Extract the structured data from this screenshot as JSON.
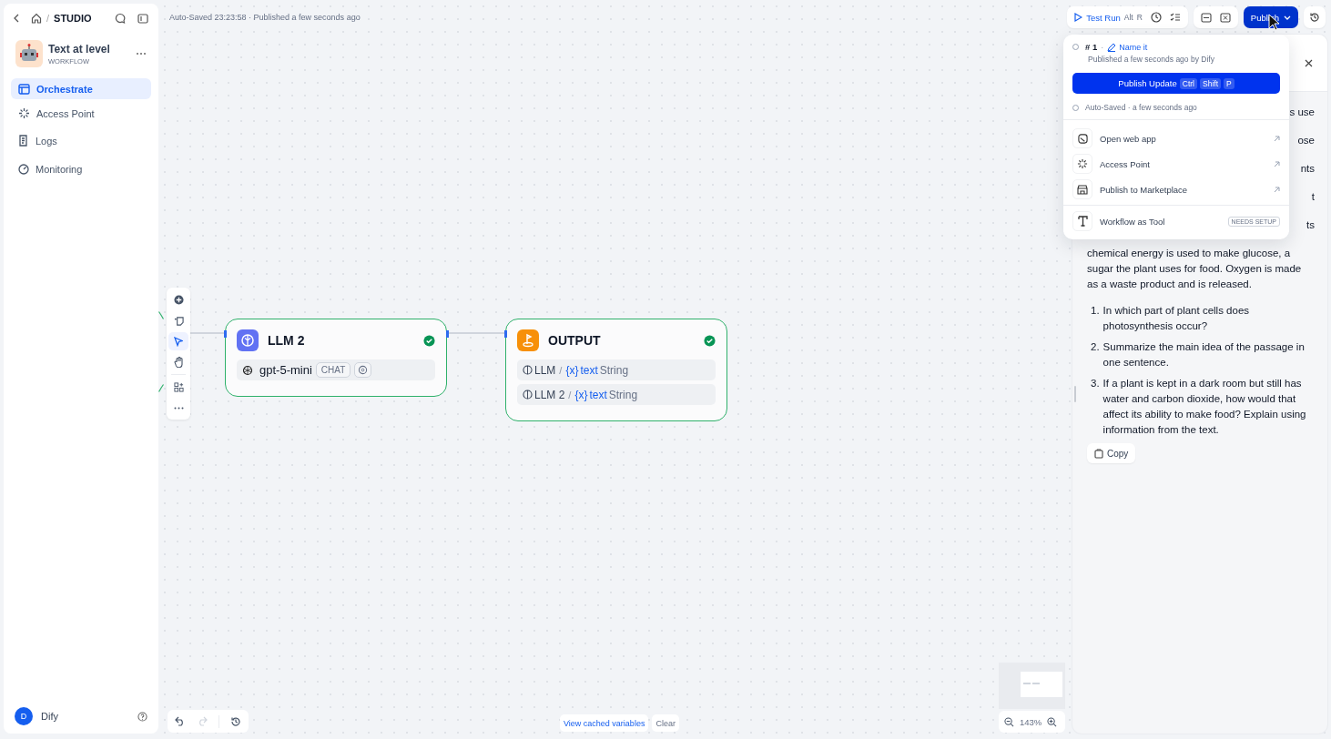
{
  "sidebar": {
    "crumb_sep": "/",
    "breadcrumb": "STUDIO",
    "app": {
      "name": "Text at level",
      "type": "WORKFLOW"
    },
    "nav": [
      {
        "label": "Orchestrate",
        "selected": true
      },
      {
        "label": "Access Point",
        "selected": false
      },
      {
        "label": "Logs",
        "selected": false
      },
      {
        "label": "Monitoring",
        "selected": false
      }
    ],
    "user": {
      "initial": "D",
      "name": "Dify"
    }
  },
  "header": {
    "status": "Auto-Saved 23:23:58 · Published a few seconds ago",
    "test_run": {
      "label": "Test Run",
      "keys": [
        "Alt",
        "R"
      ]
    },
    "publish": "Publish"
  },
  "canvas": {
    "tools": [
      {
        "kind": "add",
        "selected": false
      },
      {
        "kind": "note",
        "selected": false
      },
      {
        "kind": "pointer",
        "selected": true
      },
      {
        "kind": "hand",
        "selected": false
      },
      {
        "kind": "organize",
        "selected": false
      },
      {
        "kind": "more",
        "selected": false
      }
    ],
    "nodes": [
      {
        "kind": "llm",
        "title": "LLM 2",
        "model": "gpt-5-mini",
        "mode": "CHAT"
      },
      {
        "kind": "output",
        "title": "OUTPUT",
        "vars": [
          {
            "node": "LLM",
            "sep": "/",
            "icon": "{x}",
            "name": "text",
            "type": "String"
          },
          {
            "node": "LLM 2",
            "sep": "/",
            "icon": "{x}",
            "name": "text",
            "type": "String"
          }
        ]
      }
    ],
    "zoom": "143%",
    "cached_variables": "View cached variables",
    "clear": "Clear"
  },
  "publish_menu": {
    "version": "# 1",
    "sep": "·",
    "name_it": "Name it",
    "published": "Published a few seconds ago by Dify",
    "button": {
      "label": "Publish Update",
      "keys": [
        "Ctrl",
        "Shift",
        "P"
      ]
    },
    "auto_saved": "Auto-Saved · a few seconds ago",
    "items": [
      {
        "label": "Open web app",
        "kind": "link"
      },
      {
        "label": "Access Point",
        "kind": "link"
      },
      {
        "label": "Publish to Marketplace",
        "kind": "link"
      },
      {
        "label": "Workflow as Tool",
        "kind": "badge",
        "badge": "NEEDS SETUP"
      }
    ]
  },
  "result_panel": {
    "fragments": [
      "s use",
      "ose",
      "nts",
      "t",
      "ts"
    ],
    "paragraph": "chemical energy is used to make glucose, a sugar the plant uses for food. Oxygen is made as a waste product and is released.",
    "questions": [
      {
        "number": "1.",
        "text": "In which part of plant cells does photosynthesis occur?"
      },
      {
        "number": "2.",
        "text": "Summarize the main idea of the passage in one sentence."
      },
      {
        "number": "3.",
        "text": "If a plant is kept in a dark room but still has water and carbon dioxide, how would that affect its ability to make food? Explain using information from the text."
      }
    ],
    "copy": "Copy"
  }
}
